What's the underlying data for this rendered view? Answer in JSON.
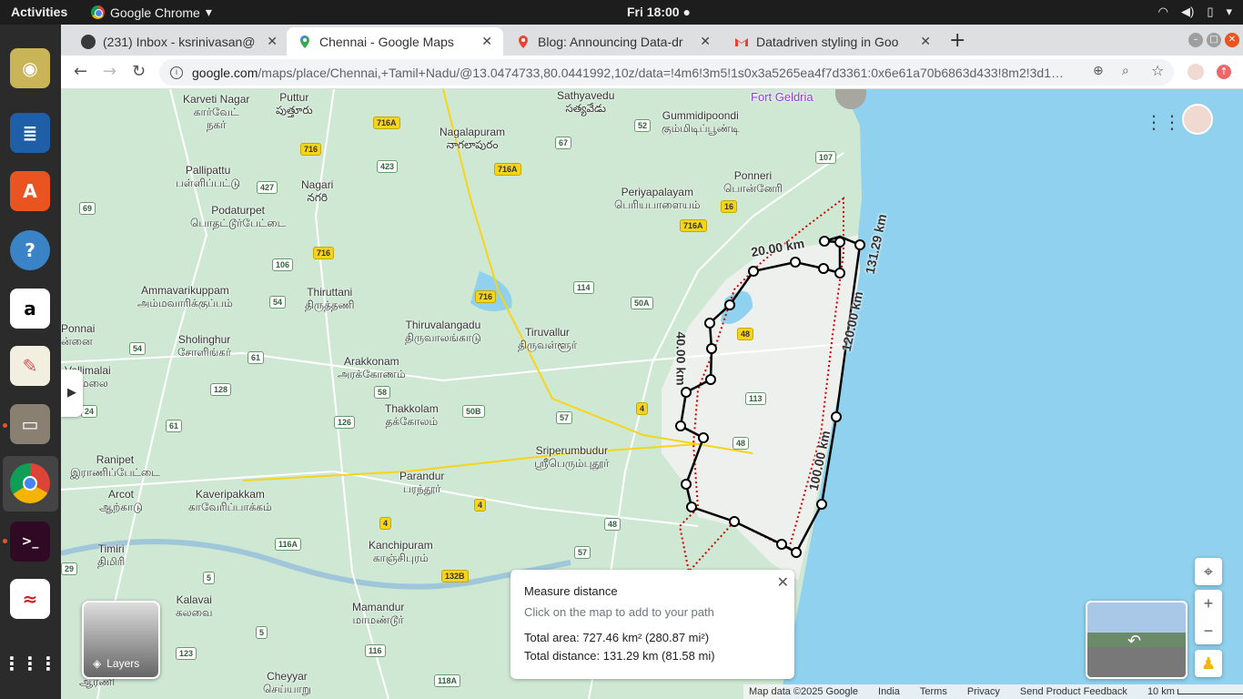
{
  "topbar": {
    "activities": "Activities",
    "app_name": "Google Chrome",
    "clock": "Fri 18:00"
  },
  "tabs": [
    {
      "title": "(231) Inbox - ksrinivasan@",
      "icon": "gmail-icon"
    },
    {
      "title": "Chennai - Google Maps",
      "icon": "maps-icon",
      "active": true
    },
    {
      "title": "Blog: Announcing Data-dr",
      "icon": "maps-icon"
    },
    {
      "title": "Datadriven styling in Goo",
      "icon": "gmail-icon"
    }
  ],
  "address": {
    "host": "google.com",
    "path": "/maps/place/Chennai,+Tamil+Nadu/@13.0474733,80.0441992,10z/data=!4m6!3m5!1s0x3a5265ea4f7d3361:0x6e61a70b6863d433!8m2!3d1…"
  },
  "map": {
    "places": [
      {
        "id": "karveti",
        "text": "Karveti Nagar\nகார்வேட்\nநகர்"
      },
      {
        "id": "puttur",
        "text": "Puttur\nపుత్తూరు"
      },
      {
        "id": "sathyavedu",
        "text": "Sathyavedu\nసత్యవేడు"
      },
      {
        "id": "gummidipoondi",
        "text": "Gummidipoondi\nகும்மிடிப்பூண்டி"
      },
      {
        "id": "nagalapuram",
        "text": "Nagalapuram\nనాగలాపురం"
      },
      {
        "id": "pallipattu",
        "text": "Pallipattu\nபள்ளிப்பட்டு"
      },
      {
        "id": "nagari",
        "text": "Nagari\nనగరి"
      },
      {
        "id": "ponneri",
        "text": "Ponneri\nபொன்னேரி"
      },
      {
        "id": "podaturpet",
        "text": "Podaturpet\nபொதட்டூர்பேட்டை"
      },
      {
        "id": "periyapalayam",
        "text": "Periyapalayam\nபெரியபாளையம்"
      },
      {
        "id": "ammavarikuppam",
        "text": "Ammavarikuppam\nஅம்மவாரிக்குப்பம்"
      },
      {
        "id": "thiruttani",
        "text": "Thiruttani\nதிருத்தணி"
      },
      {
        "id": "ponnai",
        "text": "Ponnai\nன்னை"
      },
      {
        "id": "sholinghur",
        "text": "Sholinghur\nசோளிங்கர்"
      },
      {
        "id": "thiruvalangadu",
        "text": "Thiruvalangadu\nதிருவாலங்காடு"
      },
      {
        "id": "tiruvallur",
        "text": "Tiruvallur\nதிருவள்ளூர்"
      },
      {
        "id": "vellimalai",
        "text": "Vellimalai\nிமலை"
      },
      {
        "id": "arakkonam",
        "text": "Arakkonam\nஅரக்கோணம்"
      },
      {
        "id": "thakkolam",
        "text": "Thakkolam\nதக்கோலம்"
      },
      {
        "id": "sriperumbudur",
        "text": "Sriperumbudur\nஸ்ரீபெரும்புதூர்"
      },
      {
        "id": "ranipet",
        "text": "Ranipet\nஇராணிப்பேட்டை"
      },
      {
        "id": "parandur",
        "text": "Parandur\nபரந்தூர்"
      },
      {
        "id": "arcot",
        "text": "Arcot\nஆற்காடு"
      },
      {
        "id": "kaveripakkam",
        "text": "Kaveripakkam\nகாவேரிப்பாக்கம்"
      },
      {
        "id": "timiri",
        "text": "Timiri\nதிமிரி"
      },
      {
        "id": "kanchipuram",
        "text": "Kanchipuram\nகாஞ்சிபுரம்"
      },
      {
        "id": "kalavai",
        "text": "Kalavai\nகலவை"
      },
      {
        "id": "mamandur",
        "text": "Mamandur\nமாமண்டூர்"
      },
      {
        "id": "cheyyar",
        "text": "Cheyyar\nசெய்யாறு"
      },
      {
        "id": "arani",
        "text": "ஆரணி"
      },
      {
        "id": "fort",
        "text": "Fort Geldria"
      }
    ],
    "shields": [
      {
        "id": "s716a1",
        "text": "716A",
        "kind": "y"
      },
      {
        "id": "s716a2",
        "text": "716A",
        "kind": "y"
      },
      {
        "id": "s716a3",
        "text": "716A",
        "kind": "y"
      },
      {
        "id": "s716a",
        "text": "716",
        "kind": "y"
      },
      {
        "id": "s716b",
        "text": "716",
        "kind": "y"
      },
      {
        "id": "s716c",
        "text": "716",
        "kind": "y"
      },
      {
        "id": "s52",
        "text": "52",
        "kind": "g"
      },
      {
        "id": "s67",
        "text": "67",
        "kind": "g"
      },
      {
        "id": "s107",
        "text": "107",
        "kind": "g"
      },
      {
        "id": "s423",
        "text": "423",
        "kind": "g"
      },
      {
        "id": "s427",
        "text": "427",
        "kind": "g"
      },
      {
        "id": "s69",
        "text": "69",
        "kind": "g"
      },
      {
        "id": "s16",
        "text": "16",
        "kind": "y"
      },
      {
        "id": "s106",
        "text": "106",
        "kind": "g"
      },
      {
        "id": "s54a",
        "text": "54",
        "kind": "g"
      },
      {
        "id": "s114",
        "text": "114",
        "kind": "g"
      },
      {
        "id": "s50a",
        "text": "50A",
        "kind": "g"
      },
      {
        "id": "s54b",
        "text": "54",
        "kind": "g"
      },
      {
        "id": "s61a",
        "text": "61",
        "kind": "g"
      },
      {
        "id": "s48a",
        "text": "48",
        "kind": "y"
      },
      {
        "id": "s128",
        "text": "128",
        "kind": "g"
      },
      {
        "id": "s58",
        "text": "58",
        "kind": "g"
      },
      {
        "id": "s113",
        "text": "113",
        "kind": "g"
      },
      {
        "id": "s4a",
        "text": "4",
        "kind": "y"
      },
      {
        "id": "s24",
        "text": "24",
        "kind": "g"
      },
      {
        "id": "s50b",
        "text": "50B",
        "kind": "g"
      },
      {
        "id": "s57a",
        "text": "57",
        "kind": "g"
      },
      {
        "id": "s61b",
        "text": "61",
        "kind": "g"
      },
      {
        "id": "s126",
        "text": "126",
        "kind": "g"
      },
      {
        "id": "s48b",
        "text": "48",
        "kind": "g"
      },
      {
        "id": "s4b",
        "text": "4",
        "kind": "y"
      },
      {
        "id": "s4c",
        "text": "4",
        "kind": "y"
      },
      {
        "id": "s48c",
        "text": "48",
        "kind": "g"
      },
      {
        "id": "s116a",
        "text": "116A",
        "kind": "g"
      },
      {
        "id": "s57b",
        "text": "57",
        "kind": "g"
      },
      {
        "id": "s29",
        "text": "29",
        "kind": "g"
      },
      {
        "id": "s5a",
        "text": "5",
        "kind": "g"
      },
      {
        "id": "s132b",
        "text": "132B",
        "kind": "y"
      },
      {
        "id": "s5b",
        "text": "5",
        "kind": "g"
      },
      {
        "id": "s123",
        "text": "123",
        "kind": "g"
      },
      {
        "id": "s116",
        "text": "116",
        "kind": "g"
      },
      {
        "id": "s118a",
        "text": "118A",
        "kind": "g"
      }
    ],
    "distance_labels": {
      "d20": "20.00 km",
      "d40": "40.00 km",
      "d100": "100.00 km",
      "d120": "120.00 km",
      "d131": "131.29 km"
    },
    "layers_label": "Layers"
  },
  "measure": {
    "title": "Measure distance",
    "subtitle": "Click on the map to add to your path",
    "area": "Total area: 727.46 km² (280.87 mi²)",
    "distance": "Total distance: 131.29 km (81.58 mi)"
  },
  "footer": {
    "map_data": "Map data ©2025 Google",
    "region": "India",
    "terms": "Terms",
    "privacy": "Privacy",
    "feedback": "Send Product Feedback",
    "scale": "10 km"
  },
  "colors": {
    "water": "#8fd1ee",
    "land": "#cfe8d4",
    "city": "#f1f1f3",
    "path": "#000000",
    "boundary": "#d50000"
  }
}
